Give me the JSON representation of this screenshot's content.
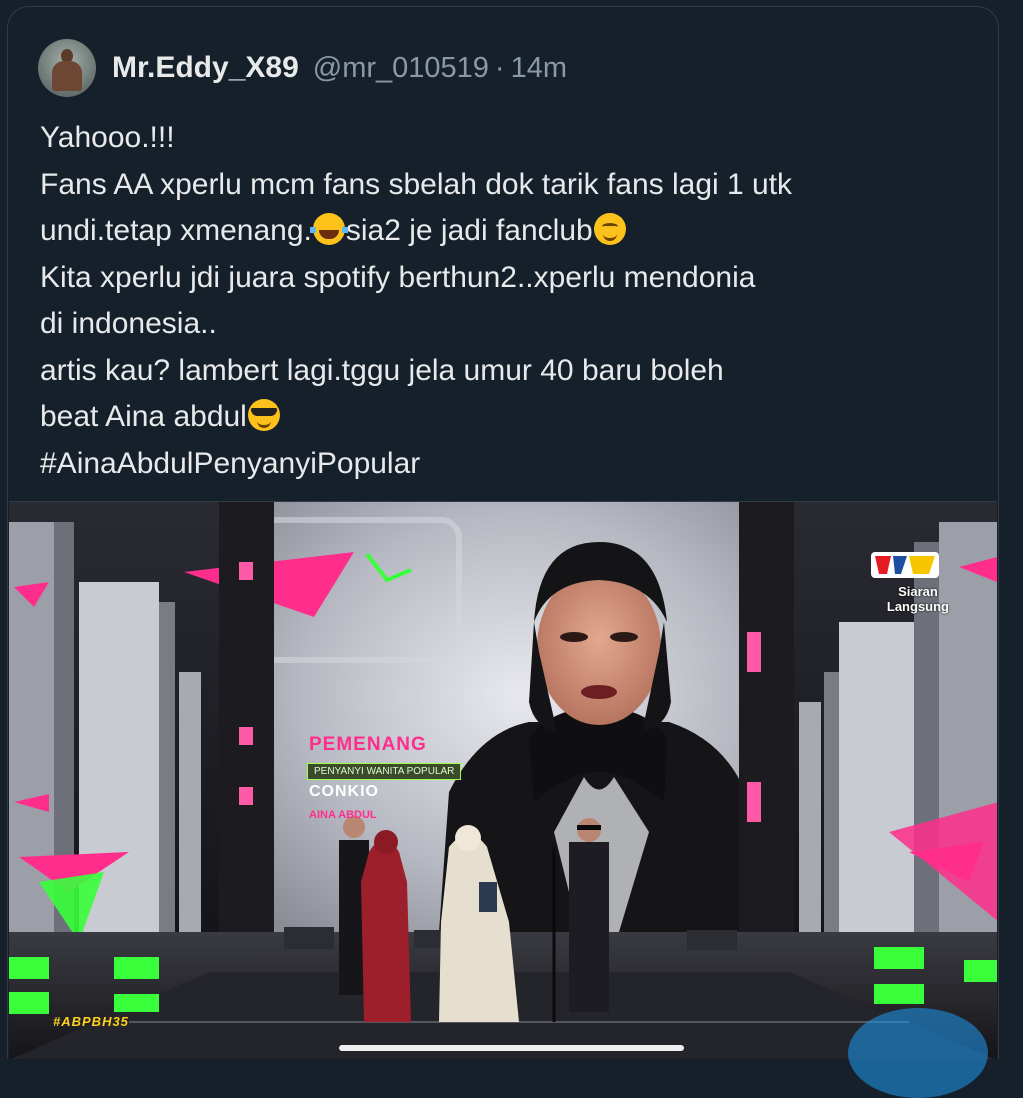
{
  "tweet": {
    "author": {
      "display_name": "Mr.Eddy_X89",
      "handle": "@mr_010519",
      "separator": "·",
      "time": "14m"
    },
    "lines": [
      "Yahooo.!!!",
      "Fans AA xperlu mcm fans sbelah dok tarik fans lagi 1 utk",
      "undi.tetap xmenang.",
      "sia2 je jadi fanclub",
      "Kita xperlu jdi juara spotify berthun2..xperlu mendonia",
      "di indonesia..",
      "artis kau? lambert lagi.tggu jela umur 40 baru boleh",
      "beat Aina abdul",
      "#AinaAbdulPenyanyiPopular"
    ],
    "emojis": {
      "laugh": "face-with-tears-of-joy-icon",
      "smile": "smiling-face-icon",
      "cool": "smiling-face-with-sunglasses-icon"
    }
  },
  "media": {
    "overlay": {
      "title": "PEMENANG",
      "category": "PENYANYI WANITA POPULAR",
      "sponsor": "CONKIO",
      "winner": "AINA ABDUL",
      "broadcaster_status_1": "Siaran",
      "broadcaster_status_2": "Langsung",
      "hashtag": "#ABPBH35"
    },
    "colors": {
      "accent_pink": "#ff2e8c",
      "neon_green": "#39ff3a",
      "stage_grey": "#b9bcc4"
    }
  }
}
